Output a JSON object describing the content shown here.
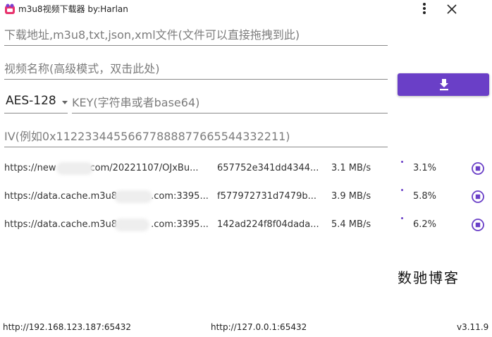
{
  "window": {
    "title": "m3u8视频下载器 by:Harlan",
    "menu_icon": "vertical-dots-icon",
    "close_icon": "close-icon"
  },
  "form": {
    "url_placeholder": "下载地址,m3u8,txt,json,xml文件(文件可以直接拖拽到此)",
    "name_placeholder": "视频名称(高级模式，双击此处)",
    "encryption_method": "AES-128",
    "key_placeholder": "KEY(字符串或者base64)",
    "iv_placeholder": "IV(例如0x11223344556677888877665544332211)",
    "download_icon": "download-icon"
  },
  "colors": {
    "accent": "#6a3fc7"
  },
  "tasks": [
    {
      "url_start": "https://new",
      "url_end": "com/20221107/OJxBu...",
      "hash": "657752e341dd4344...",
      "speed": "3.1 MB/s",
      "progress": "3.1%"
    },
    {
      "url_start": "https://data.cache.m3u8",
      "url_end": ".com:3395...",
      "hash": "f577972731d7479b...",
      "speed": "3.9 MB/s",
      "progress": "5.8%"
    },
    {
      "url_start": "https://data.cache.m3u8",
      "url_end": ".com:3395...",
      "hash": "142ad224f8f04dada...",
      "speed": "5.4 MB/s",
      "progress": "6.2%"
    }
  ],
  "watermark": "数驰博客",
  "footer": {
    "lan_address": "http://192.168.123.187:65432",
    "local_address": "http://127.0.0.1:65432",
    "version": "v3.11.9"
  }
}
